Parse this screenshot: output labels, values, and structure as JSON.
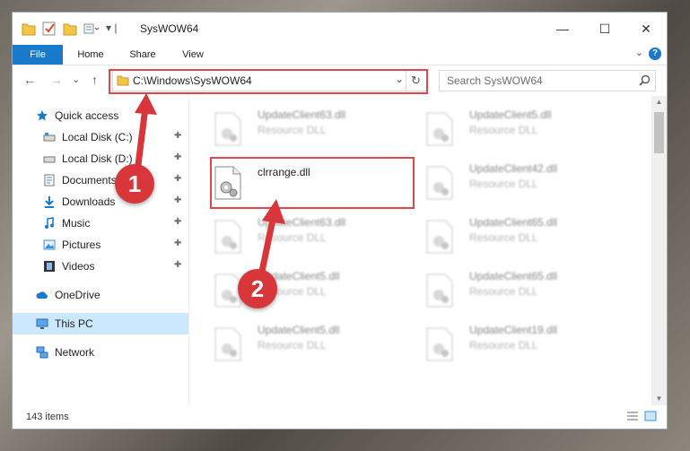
{
  "window": {
    "title": "SysWOW64",
    "min_glyph": "—",
    "max_glyph": "☐",
    "close_glyph": "✕"
  },
  "ribbon": {
    "tabs": [
      "File",
      "Home",
      "Share",
      "View"
    ],
    "help_glyph": "?",
    "expand_glyph": "⌄"
  },
  "navigation": {
    "back_glyph": "←",
    "forward_glyph": "→",
    "recent_glyph": "⌄",
    "up_glyph": "↑"
  },
  "address": {
    "path": "C:\\Windows\\SysWOW64",
    "dropdown_glyph": "⌄",
    "refresh_glyph": "↻"
  },
  "search": {
    "placeholder": "Search SysWOW64",
    "icon": "search-icon"
  },
  "sidebar": {
    "items": [
      {
        "label": "Quick access",
        "icon": "star-icon",
        "pinned": false
      },
      {
        "label": "Local Disk (C:)",
        "icon": "drive-icon",
        "pinned": true
      },
      {
        "label": "Local Disk (D:)",
        "icon": "drive-icon",
        "pinned": true
      },
      {
        "label": "Documents",
        "icon": "documents-icon",
        "pinned": true
      },
      {
        "label": "Downloads",
        "icon": "download-icon",
        "pinned": true
      },
      {
        "label": "Music",
        "icon": "music-icon",
        "pinned": true
      },
      {
        "label": "Pictures",
        "icon": "pictures-icon",
        "pinned": true
      },
      {
        "label": "Videos",
        "icon": "videos-icon",
        "pinned": true
      },
      {
        "label": "OneDrive",
        "icon": "cloud-icon",
        "pinned": false
      },
      {
        "label": "This PC",
        "icon": "computer-icon",
        "pinned": false,
        "selected": true
      },
      {
        "label": "Network",
        "icon": "network-icon",
        "pinned": false
      }
    ],
    "pin_glyph": "📌"
  },
  "files": [
    {
      "name": "UpdateClient63.dll",
      "type": "Resource DLL",
      "blurred": true
    },
    {
      "name": "UpdateClient5.dll",
      "type": "Resource DLL",
      "blurred": true
    },
    {
      "name": "clrrange.dll",
      "type": "",
      "blurred": false,
      "highlighted": true
    },
    {
      "name": "UpdateClient42.dll",
      "type": "Resource DLL",
      "blurred": true
    },
    {
      "name": "UpdateClient63.dll",
      "type": "Resource DLL",
      "blurred": true
    },
    {
      "name": "UpdateClient65.dll",
      "type": "Resource DLL",
      "blurred": true
    },
    {
      "name": "UpdateClient5.dll",
      "type": "Resource DLL",
      "blurred": true
    },
    {
      "name": "UpdateClient65.dll",
      "type": "Resource DLL",
      "blurred": true
    },
    {
      "name": "UpdateClient5.dll",
      "type": "Resource DLL",
      "blurred": true
    },
    {
      "name": "UpdateClient19.dll",
      "type": "Resource DLL",
      "blurred": true
    }
  ],
  "status": {
    "item_count": "143 items"
  },
  "annotations": {
    "step1": "1",
    "step2": "2",
    "color": "#d8363b"
  },
  "colors": {
    "accent": "#1979ca",
    "highlight": "#e0464a",
    "selected_bg": "#cce8ff"
  }
}
